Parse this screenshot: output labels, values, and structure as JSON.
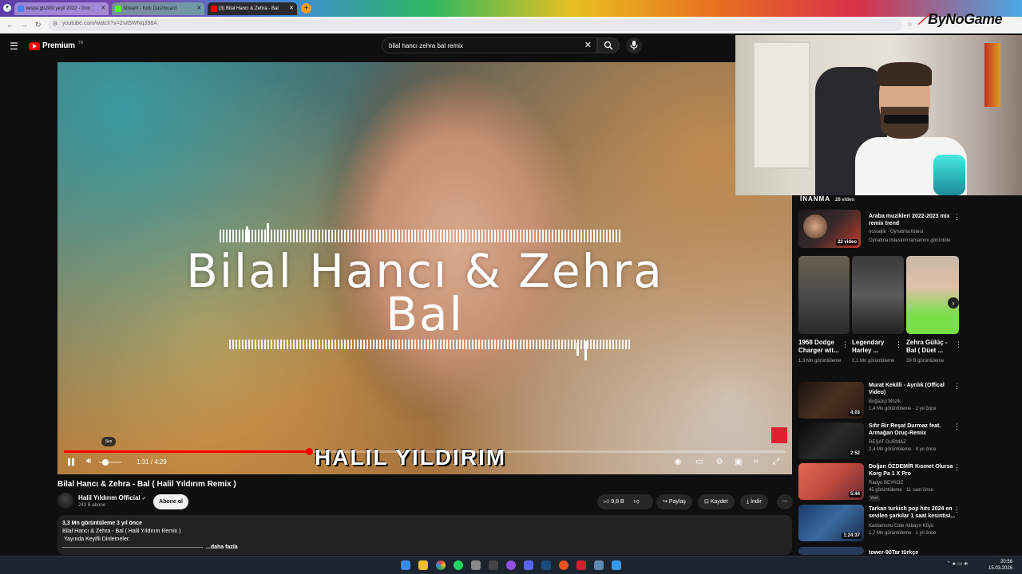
{
  "browser": {
    "tabs": [
      {
        "label": "vespa gts300 yeşil 2022 - Goo",
        "color": "#4285f4"
      },
      {
        "label": "Stream - Kick Dashboard",
        "color": "#53fc18"
      },
      {
        "label": "(3) Bilal Hancı & Zehra - Bal",
        "color": "#ff0000"
      }
    ],
    "url": "youtube.com/watch?v=Zwt5WNq398A",
    "watermark": "ByNoGame"
  },
  "yt": {
    "logo_text": "Premium",
    "country_code": "TR",
    "search_value": "bilal hancı zehra bal remix"
  },
  "player": {
    "title_line1": "Bilal Hancı & Zehra",
    "title_line2": "Bal",
    "artist_banner": "HALIL YILDIRIM",
    "time": "1:31 / 4:29",
    "volume_tooltip": "Ses",
    "progress": 0.34,
    "volume": 0.3
  },
  "video": {
    "title": "Bilal Hancı & Zehra - Bal ( Halil Yıldırım Remix )",
    "channel": "Halil Yıldırım Official",
    "verified_icon": "verified-icon",
    "subscribers": "243 B abone",
    "subscribe_label": "Abone ol",
    "likes": "9,8 B",
    "share_label": "Paylaş",
    "save_label": "Kaydet",
    "download_label": "İndir",
    "desc_stats": "3,3 Mn görüntüleme  3 yıl önce",
    "desc_line1": "Bilal Hancı & Zehra - Bal ( Halil Yıldırım Remix )",
    "desc_line2": "Yayında Keyifli Dinlemeler.",
    "more_label": "...daha fazla"
  },
  "sidebar": {
    "playlist_header": "İNANMA",
    "playlist_count": "28 video",
    "playlist": {
      "title": "Araba muzikleri 2022-2023 mix remix trend",
      "meta1": "nostaljik · Oynatma listesi",
      "meta2": "Oynatma listesinin tamamını görüntüle",
      "badge": "22 video"
    },
    "shorts": [
      {
        "title": "1968 Dodge Charger wit...",
        "meta": "1,3 Mn görüntüleme"
      },
      {
        "title": "Legendary Harley ...",
        "meta": "2,1 Mn görüntüleme"
      },
      {
        "title": "Zehra Gülüç - Bal ( Düet ...",
        "meta": "39 B görüntüleme"
      }
    ],
    "videos": [
      {
        "title": "Murat Kekilli - Ayrılık (Offical Video)",
        "channel": "Boğaziçi Müzik",
        "meta": "1,4 Mn görüntüleme · 2 yıl önce",
        "duration": "4:03"
      },
      {
        "title": "Sıfır Bir Reşat Durmaz feat. Armağan Oruç-Remix",
        "channel": "REŞAT DURMAZ",
        "meta": "2,4 Mn görüntüleme · 8 yıl önce",
        "duration": "2:52"
      },
      {
        "title": "Doğan ÖZDEMİR Kısmet Olursa Korg Pa 1 X Pro",
        "channel": "Radyo BEYKOZ",
        "meta": "45 görüntüleme · 11 saat önce",
        "duration": "5:44",
        "badge": "Yeni"
      },
      {
        "title": "Tarkan turkish  pop hıts 2024 en sevilen şarkılar 1 saat kesintisi...",
        "channel": "Kastamonu Cide Akbayır Köyü",
        "meta": "1,7 Mn görüntüleme · 1 yıl önce",
        "duration": "1:24:37"
      },
      {
        "title": "tower-90Tar türkçe",
        "channel": "",
        "meta": "",
        "duration": ""
      }
    ]
  },
  "taskbar": {
    "time": "20:56",
    "date": "15.03.2026"
  }
}
